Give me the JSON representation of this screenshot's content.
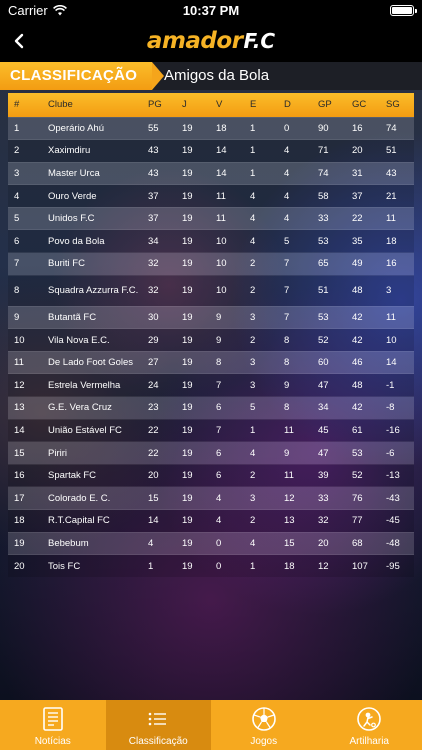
{
  "status_bar": {
    "carrier": "Carrier",
    "time": "10:37 PM"
  },
  "header": {
    "logo_main": "amador",
    "logo_suffix": "F.C"
  },
  "section": {
    "tab_label": "CLASSIFICAÇÃO",
    "league": "Amigos da Bola"
  },
  "table": {
    "columns": [
      "#",
      "Clube",
      "PG",
      "J",
      "V",
      "E",
      "D",
      "GP",
      "GC",
      "SG"
    ],
    "rows": [
      [
        "1",
        "Operário Ahú",
        "55",
        "19",
        "18",
        "1",
        "0",
        "90",
        "16",
        "74"
      ],
      [
        "2",
        "Xaximdiru",
        "43",
        "19",
        "14",
        "1",
        "4",
        "71",
        "20",
        "51"
      ],
      [
        "3",
        "Master Urca",
        "43",
        "19",
        "14",
        "1",
        "4",
        "74",
        "31",
        "43"
      ],
      [
        "4",
        "Ouro Verde",
        "37",
        "19",
        "11",
        "4",
        "4",
        "58",
        "37",
        "21"
      ],
      [
        "5",
        "Unidos F.C",
        "37",
        "19",
        "11",
        "4",
        "4",
        "33",
        "22",
        "11"
      ],
      [
        "6",
        "Povo da Bola",
        "34",
        "19",
        "10",
        "4",
        "5",
        "53",
        "35",
        "18"
      ],
      [
        "7",
        "Buriti FC",
        "32",
        "19",
        "10",
        "2",
        "7",
        "65",
        "49",
        "16"
      ],
      [
        "8",
        "Squadra Azzurra F.C.",
        "32",
        "19",
        "10",
        "2",
        "7",
        "51",
        "48",
        "3"
      ],
      [
        "9",
        "Butantã FC",
        "30",
        "19",
        "9",
        "3",
        "7",
        "53",
        "42",
        "11"
      ],
      [
        "10",
        "Vila Nova E.C.",
        "29",
        "19",
        "9",
        "2",
        "8",
        "52",
        "42",
        "10"
      ],
      [
        "11",
        "De Lado Foot Goles",
        "27",
        "19",
        "8",
        "3",
        "8",
        "60",
        "46",
        "14"
      ],
      [
        "12",
        "Estrela Vermelha",
        "24",
        "19",
        "7",
        "3",
        "9",
        "47",
        "48",
        "-1"
      ],
      [
        "13",
        "G.E. Vera Cruz",
        "23",
        "19",
        "6",
        "5",
        "8",
        "34",
        "42",
        "-8"
      ],
      [
        "14",
        "União Estável FC",
        "22",
        "19",
        "7",
        "1",
        "11",
        "45",
        "61",
        "-16"
      ],
      [
        "15",
        "Piriri",
        "22",
        "19",
        "6",
        "4",
        "9",
        "47",
        "53",
        "-6"
      ],
      [
        "16",
        "Spartak FC",
        "20",
        "19",
        "6",
        "2",
        "11",
        "39",
        "52",
        "-13"
      ],
      [
        "17",
        "Colorado E. C.",
        "15",
        "19",
        "4",
        "3",
        "12",
        "33",
        "76",
        "-43"
      ],
      [
        "18",
        "R.T.Capital FC",
        "14",
        "19",
        "4",
        "2",
        "13",
        "32",
        "77",
        "-45"
      ],
      [
        "19",
        "Bebebum",
        "4",
        "19",
        "0",
        "4",
        "15",
        "20",
        "68",
        "-48"
      ],
      [
        "20",
        "Tois FC",
        "1",
        "19",
        "0",
        "1",
        "18",
        "12",
        "107",
        "-95"
      ]
    ]
  },
  "tab_bar": {
    "items": [
      {
        "label": "Notícias",
        "icon": "newspaper-icon"
      },
      {
        "label": "Classificação",
        "icon": "list-icon",
        "active": true
      },
      {
        "label": "Jogos",
        "icon": "soccer-ball-icon"
      },
      {
        "label": "Artilharia",
        "icon": "scorer-icon"
      }
    ]
  },
  "colors": {
    "accent": "#f6a91f",
    "accent_dark": "#d88b10",
    "bar": "#000000"
  }
}
